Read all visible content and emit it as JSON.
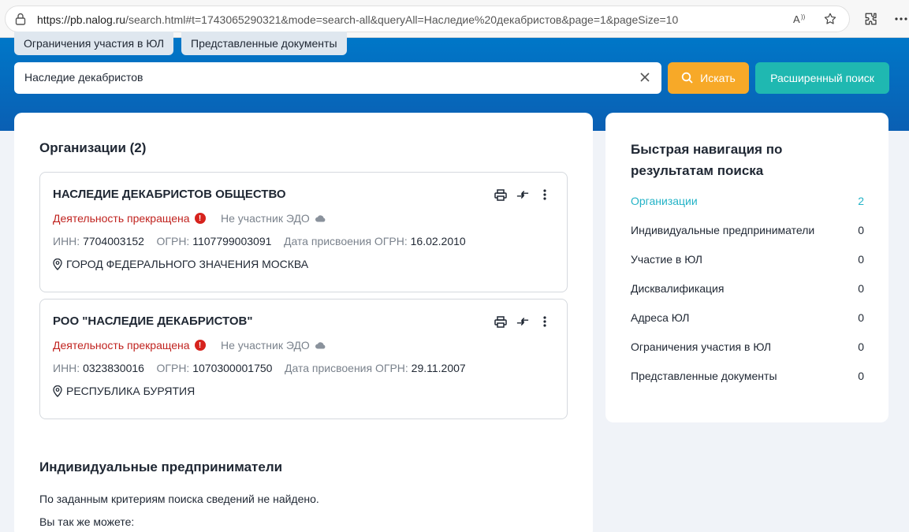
{
  "browser": {
    "url_host": "https://pb.nalog.ru",
    "url_rest": "/search.html#t=1743065290321&mode=search-all&queryAll=Наследие%20декабристов&page=1&pageSize=10",
    "read_aloud_icon": "read-aloud-icon",
    "favorite_icon": "star-icon",
    "extensions_icon": "puzzle-icon",
    "more_icon": "ellipsis-icon"
  },
  "tabs": {
    "t1": "Ограничения участия в ЮЛ",
    "t2": "Представленные документы"
  },
  "search": {
    "value": "Наследие декабристов",
    "search_button": "Искать",
    "advanced_button": "Расширенный поиск"
  },
  "main": {
    "orgs_title": "Организации (2)",
    "orgs": [
      {
        "name": "НАСЛЕДИЕ ДЕКАБРИСТОВ ОБЩЕСТВО",
        "status": "Деятельность прекращена",
        "edo": "Не участник ЭДО",
        "inn_label": "ИНН:",
        "inn": "7704003152",
        "ogrn_label": "ОГРН:",
        "ogrn": "1107799003091",
        "date_label": "Дата присвоения ОГРН:",
        "date": "16.02.2010",
        "address": "ГОРОД ФЕДЕРАЛЬНОГО ЗНАЧЕНИЯ МОСКВА"
      },
      {
        "name": "РОО \"НАСЛЕДИЕ ДЕКАБРИСТОВ\"",
        "status": "Деятельность прекращена",
        "edo": "Не участник ЭДО",
        "inn_label": "ИНН:",
        "inn": "0323830016",
        "ogrn_label": "ОГРН:",
        "ogrn": "1070300001750",
        "date_label": "Дата присвоения ОГРН:",
        "date": "29.11.2007",
        "address": "РЕСПУБЛИКА БУРЯТИЯ"
      }
    ],
    "ip_title": "Индивидуальные предприниматели",
    "ip_not_found": "По заданным критериям поиска сведений не найдено.",
    "ip_also": "Вы так же можете:"
  },
  "side": {
    "title": "Быстрая навигация по результатам поиска",
    "items": [
      {
        "label": "Организации",
        "count": "2"
      },
      {
        "label": "Индивидуальные предприниматели",
        "count": "0"
      },
      {
        "label": "Участие в ЮЛ",
        "count": "0"
      },
      {
        "label": "Дисквалификация",
        "count": "0"
      },
      {
        "label": "Адреса ЮЛ",
        "count": "0"
      },
      {
        "label": "Ограничения участия в ЮЛ",
        "count": "0"
      },
      {
        "label": "Представленные документы",
        "count": "0"
      }
    ],
    "active_color": "#23b3c7"
  },
  "colors": {
    "header_blue": "#0077c8",
    "search_orange": "#f7a928",
    "advanced_teal": "#1fb8b1",
    "status_red": "#c0231f"
  }
}
